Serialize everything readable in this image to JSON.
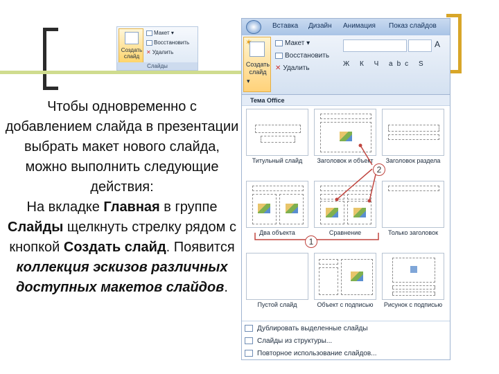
{
  "mini_ribbon": {
    "new_slide_label": "Создать слайд",
    "layout_label": "Макет",
    "reset_label": "Восстановить",
    "delete_label": "Удалить",
    "group_label": "Слайды"
  },
  "text": {
    "line1": "Чтобы одновременно с добавлением слайда в презентации выбрать макет нового слайда, можно выполнить следующие действия:",
    "p2_a": "На вкладке ",
    "p2_b": "Главная",
    "p2_c": " в группе ",
    "p2_d": "Слайды",
    "p2_e": " щелкнуть стрелку рядом с кнопкой ",
    "p2_f": "Создать слайд",
    "p2_g": ". Появится ",
    "p2_h": "коллекция эскизов различных доступных макетов слайдов",
    "p2_i": "."
  },
  "ribbon": {
    "tabs": [
      "Вставка",
      "Дизайн",
      "Анимация",
      "Показ слайдов"
    ],
    "new_slide_label": "Создать слайд",
    "layout_label": "Макет",
    "reset_label": "Восстановить",
    "delete_label": "Удалить",
    "format_buttons": "Ж К Ч abc S"
  },
  "gallery": {
    "header": "Тема Office",
    "layouts": [
      {
        "label": "Титульный слайд"
      },
      {
        "label": "Заголовок и объект"
      },
      {
        "label": "Заголовок раздела"
      },
      {
        "label": "Два объекта"
      },
      {
        "label": "Сравнение"
      },
      {
        "label": "Только заголовок"
      },
      {
        "label": "Пустой слайд"
      },
      {
        "label": "Объект с подписью"
      },
      {
        "label": "Рисунок с подписью"
      }
    ],
    "menu": [
      {
        "label": "Дублировать выделенные слайды"
      },
      {
        "label": "Слайды из структуры..."
      },
      {
        "label": "Повторное использование слайдов..."
      }
    ]
  },
  "callouts": {
    "one": "1",
    "two": "2"
  },
  "colors": {
    "callout_line": "#c0453f",
    "bracket_right": "#d8a629",
    "accent_line": "#cfdc8e"
  }
}
